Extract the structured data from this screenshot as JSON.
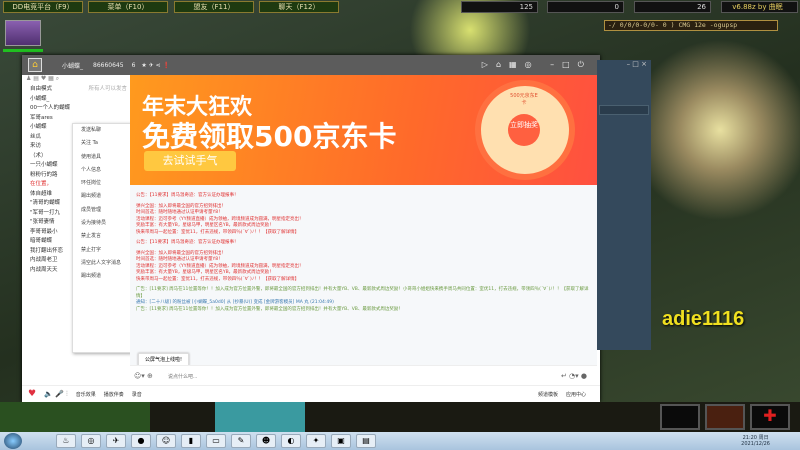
{
  "game": {
    "menu_buttons": [
      "DD电竞平台（F9）",
      "菜单（F10）",
      "盟友（F11）",
      "聊天（F12）"
    ],
    "gold": "125",
    "lumber": "0",
    "food": "26",
    "version": "v6.88z by 曲眠",
    "status_line": "-/ 0/0/0-0/0- 0 ) CMG 12e -ogupsp",
    "overlay_name": "adie1116"
  },
  "yy": {
    "room_name": "小蝴蝶_",
    "room_id": "86660645",
    "online_count": "6",
    "left_panel": {
      "mode": "自由模式",
      "hint": "所有人可以发言",
      "items": [
        "小蝴蝶_",
        "00一个人的蝴蝶",
        "军哥ares",
        "小蝴蝶",
        "丝瓜",
        "来访",
        "（术）",
        "一只小蝴蝶",
        "粉粉行的路",
        "在位置，",
        "体自超维",
        "\"清哥的蝴蝶",
        "\"军哥一打九",
        "\"张哥妻情",
        "李哥哥最小",
        "暗哥蝴蝶",
        "我打翻出怀恋",
        "内战周老卫",
        "内战周天天"
      ]
    },
    "context_menu": [
      "发送私聊",
      "关注 Ta",
      "使用道具",
      "个人信息",
      "环任岗位",
      "踢出频道",
      "成员管理",
      "设为接待员",
      "禁止发言",
      "禁止打字",
      "清空此人文字消息",
      "踢出频道"
    ],
    "banner": {
      "line1": "年末大狂欢",
      "line2": "免费领取500京东卡",
      "button": "去试试手气",
      "wheel_center": "立即抽奖",
      "wheel_top": "500元京东E卡"
    },
    "chat": [
      {
        "cls": "red",
        "text": "公告：【11要求】周马温奇迹：官方认证办理报事！"
      },
      {
        "cls": "red",
        "text": "弹兴全国：加入即将最全国的官方招到排出！"
      },
      {
        "cls": "red",
        "text": "时间首选：随时随地通过认证申请考量Y8！"
      },
      {
        "cls": "red",
        "text": "活动课程：迈可参考（YY频道直播）成为领袖，跨境频道成为圆满，明星指定亮出！"
      },
      {
        "cls": "red",
        "text": "奖励丰富：有大量YB，星级马甲，明星区名YB，最新款式周边奖励！"
      },
      {
        "cls": "red",
        "text": "快来带周马一起位置：室优11，打去违规，带领四％(´∀`)ﾉ！！【获取了解详情】"
      },
      {
        "cls": "red",
        "text": "公告：【11要求】周马温奇迹：官方认证办理报事！"
      },
      {
        "cls": "red",
        "text": "弹兴全国：加入即将最全国的官方招到排出！"
      },
      {
        "cls": "red",
        "text": "时间首选：随时随地通过认证申请考量Y8！"
      },
      {
        "cls": "red",
        "text": "活动课程：迈可参考（YY频道直播）成为领袖，跨境频道成为圆满，明星指定亮出！"
      },
      {
        "cls": "red",
        "text": "奖励丰富：有大量YB，星级马甲，明星区名YB，最新款式周边奖励！"
      },
      {
        "cls": "red",
        "text": "快来带周马一起位置：室优11，打去违规，带领四％(´∀`)ﾉ！！【获取了解详情】"
      },
      {
        "cls": "grn",
        "text": "广告：[11要求] 周马在11位置等你！！加入成为官方位置外警，即将最全国的官方招到排出！并有大量YB、VB、最新款式周边奖励！小哥哥小姐姐快来携手周马共同位置：室优11，打去违规，带领四％(´∀`)ﾉ！！【获取了解详情】"
      },
      {
        "cls": "blu",
        "text": "通知：[二十八级] 的粉丝被 [小蝴蝶_5a0d0] 从 [抄暴(U)] 变成 [金牌游客模员] MA 丸 (21:04:49)"
      },
      {
        "cls": "grn",
        "text": "广告：[11要求] 周马在11位置等你！！加入成为官方位置外警，即将最全国的官方招到排出！并有大量YB、VB、最新款式周边奖励！"
      }
    ],
    "tooltip": "公屏气泡上线啦!",
    "input_placeholder": "说点什么吧...",
    "bottom_left": [
      "音乐效果",
      "播放伴奏",
      "录音"
    ],
    "bottom_right": [
      "频道模板",
      "应用中心"
    ]
  },
  "taskbar": {
    "time": "21:20 周日",
    "date": "2021/12/26"
  }
}
